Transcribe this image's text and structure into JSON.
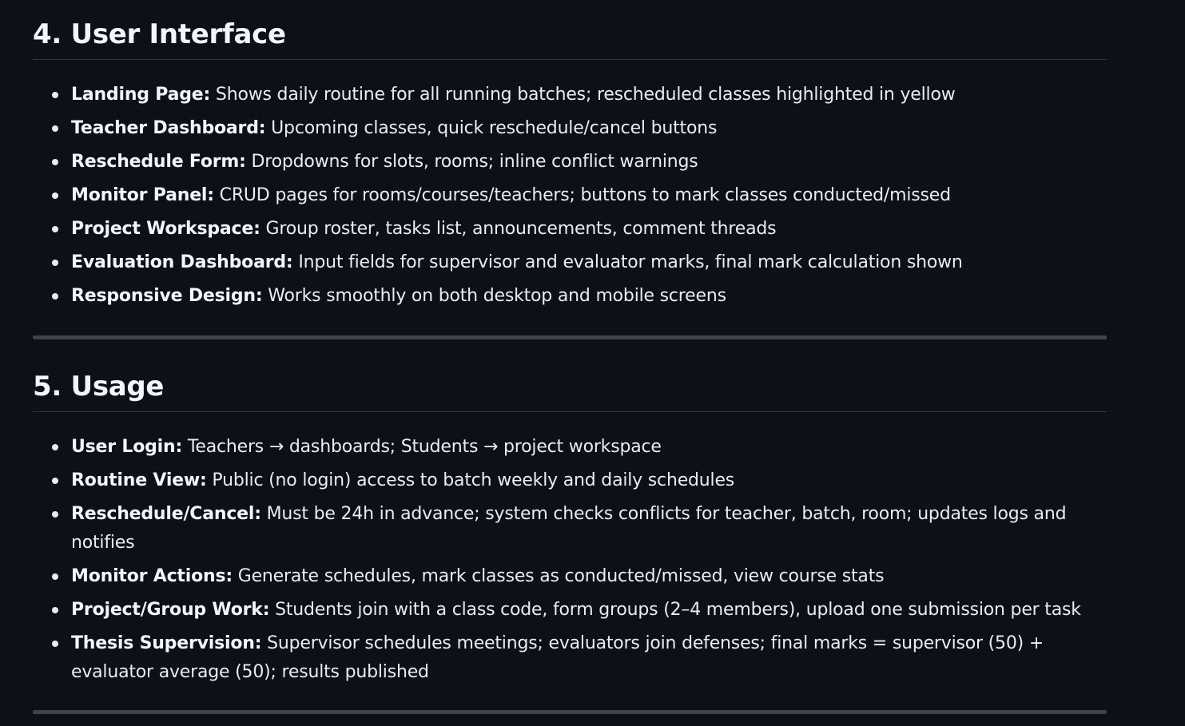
{
  "sections": [
    {
      "title": "4. User Interface",
      "items": [
        {
          "term": "Landing Page:",
          "text": " Shows daily routine for all running batches; rescheduled classes highlighted in yellow"
        },
        {
          "term": "Teacher Dashboard:",
          "text": " Upcoming classes, quick reschedule/cancel buttons"
        },
        {
          "term": "Reschedule Form:",
          "text": " Dropdowns for slots, rooms; inline conflict warnings"
        },
        {
          "term": "Monitor Panel:",
          "text": " CRUD pages for rooms/courses/teachers; buttons to mark classes conducted/missed"
        },
        {
          "term": "Project Workspace:",
          "text": " Group roster, tasks list, announcements, comment threads"
        },
        {
          "term": "Evaluation Dashboard:",
          "text": " Input fields for supervisor and evaluator marks, final mark calculation shown"
        },
        {
          "term": "Responsive Design:",
          "text": " Works smoothly on both desktop and mobile screens"
        }
      ]
    },
    {
      "title": "5. Usage",
      "items": [
        {
          "term": "User Login:",
          "text": " Teachers → dashboards; Students → project workspace"
        },
        {
          "term": "Routine View:",
          "text": " Public (no login) access to batch weekly and daily schedules"
        },
        {
          "term": "Reschedule/Cancel:",
          "text": " Must be 24h in advance; system checks conflicts for teacher, batch, room; updates logs and notifies"
        },
        {
          "term": "Monitor Actions:",
          "text": " Generate schedules, mark classes as conducted/missed, view course stats"
        },
        {
          "term": "Project/Group Work:",
          "text": " Students join with a class code, form groups (2–4 members), upload one submission per task"
        },
        {
          "term": "Thesis Supervision:",
          "text": " Supervisor schedules meetings; evaluators join defenses; final marks = supervisor (50) + evaluator average (50); results published"
        }
      ]
    }
  ]
}
